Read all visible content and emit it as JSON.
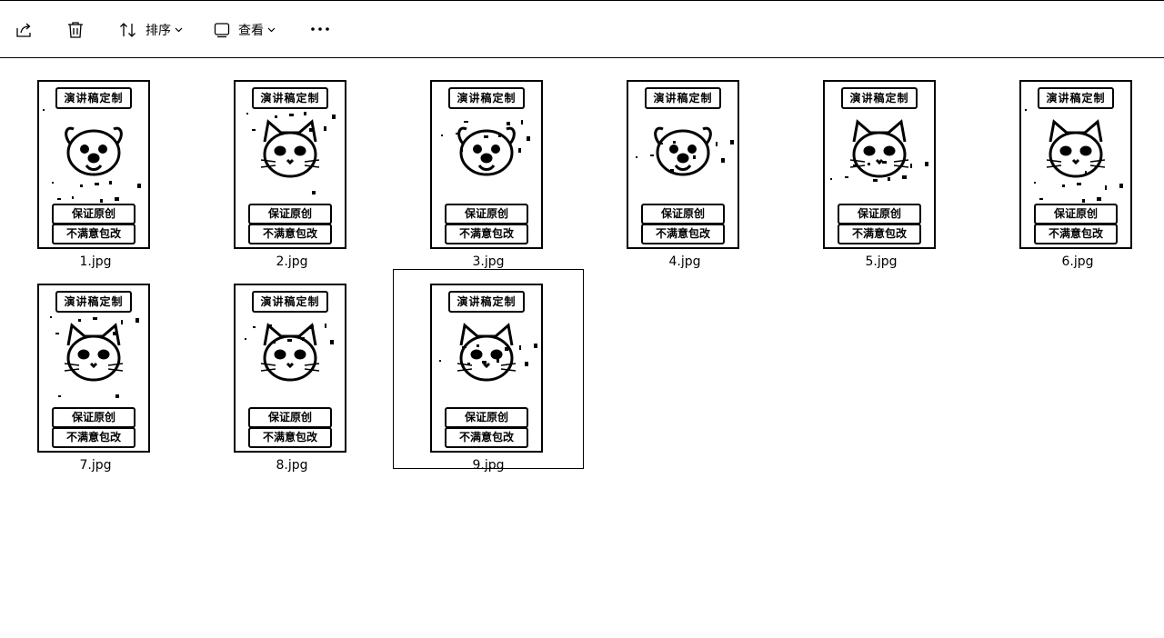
{
  "toolbar": {
    "share_icon": "share-icon",
    "delete_icon": "trash-icon",
    "sort_label": "排序",
    "view_label": "查看",
    "more_icon": "more-horizontal-icon"
  },
  "files": [
    {
      "name": "1.jpg",
      "banner": "演讲稿定制",
      "cap1": "保证原创",
      "cap2": "不满意包改",
      "pet": "dog"
    },
    {
      "name": "2.jpg",
      "banner": "演讲稿定制",
      "cap1": "保证原创",
      "cap2": "不满意包改",
      "pet": "cat"
    },
    {
      "name": "3.jpg",
      "banner": "演讲稿定制",
      "cap1": "保证原创",
      "cap2": "不满意包改",
      "pet": "dog"
    },
    {
      "name": "4.jpg",
      "banner": "演讲稿定制",
      "cap1": "保证原创",
      "cap2": "不满意包改",
      "pet": "dog"
    },
    {
      "name": "5.jpg",
      "banner": "演讲稿定制",
      "cap1": "保证原创",
      "cap2": "不满意包改",
      "pet": "cat"
    },
    {
      "name": "6.jpg",
      "banner": "演讲稿定制",
      "cap1": "保证原创",
      "cap2": "不满意包改",
      "pet": "cat"
    },
    {
      "name": "7.jpg",
      "banner": "演讲稿定制",
      "cap1": "保证原创",
      "cap2": "不满意包改",
      "pet": "cat"
    },
    {
      "name": "8.jpg",
      "banner": "演讲稿定制",
      "cap1": "保证原创",
      "cap2": "不满意包改",
      "pet": "cat"
    },
    {
      "name": "9.jpg",
      "banner": "演讲稿定制",
      "cap1": "保证原创",
      "cap2": "不满意包改",
      "pet": "cat",
      "selected": true
    }
  ]
}
